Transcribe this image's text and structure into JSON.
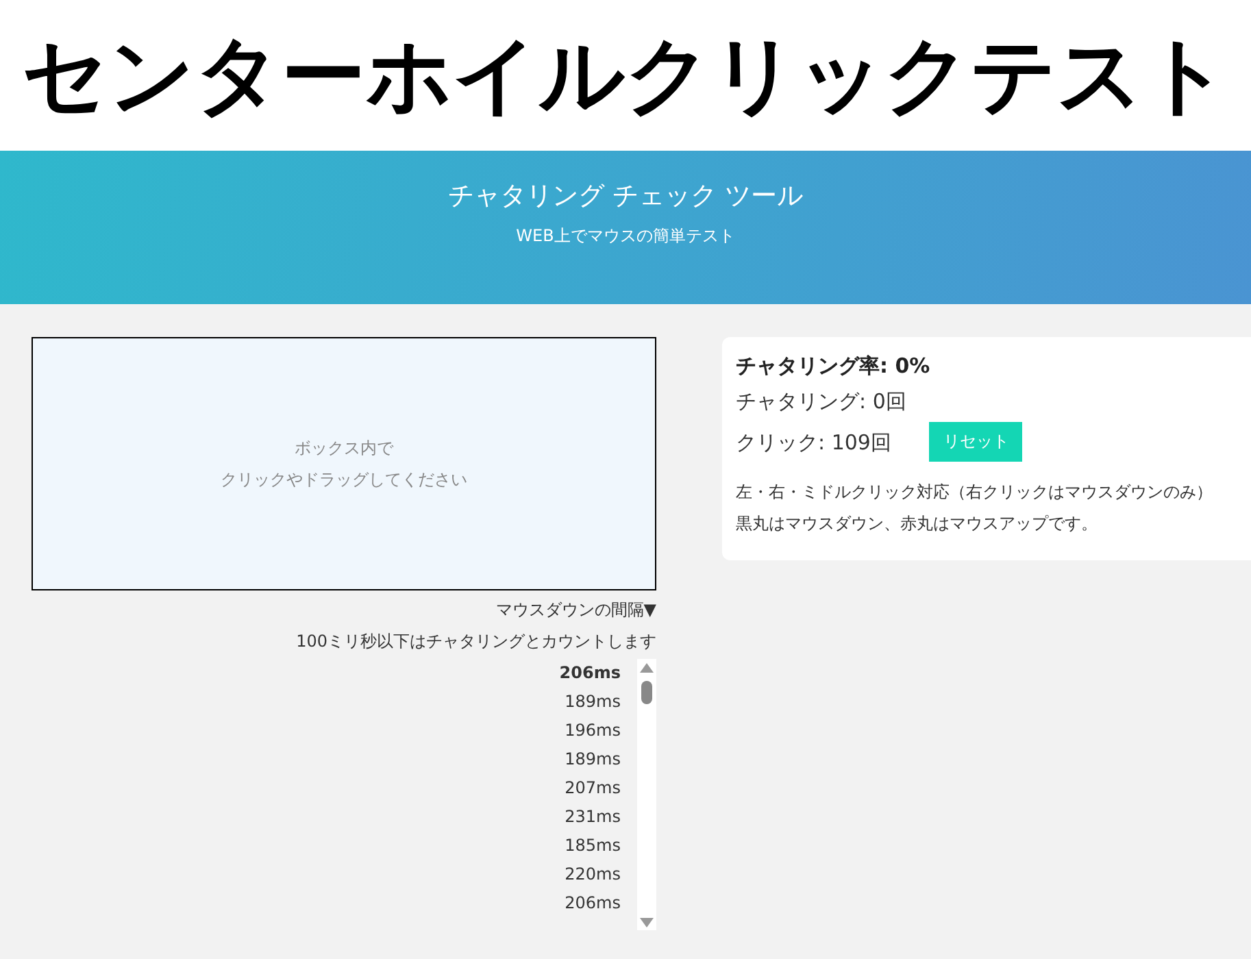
{
  "page_title": "センターホイルクリックテスト",
  "banner": {
    "title": "チャタリング チェック ツール",
    "subtitle": "WEB上でマウスの簡単テスト"
  },
  "test_area": {
    "line_1": "ボックス内で",
    "line_2": "クリックやドラッグしてください"
  },
  "interval_header": "マウスダウンの間隔▼",
  "interval_note": "100ミリ秒以下はチャタリングとカウントします",
  "intervals": [
    {
      "value": "206ms",
      "latest": true
    },
    {
      "value": "189ms",
      "latest": false
    },
    {
      "value": "196ms",
      "latest": false
    },
    {
      "value": "189ms",
      "latest": false
    },
    {
      "value": "207ms",
      "latest": false
    },
    {
      "value": "231ms",
      "latest": false
    },
    {
      "value": "185ms",
      "latest": false
    },
    {
      "value": "220ms",
      "latest": false
    },
    {
      "value": "206ms",
      "latest": false
    }
  ],
  "stats": {
    "rate": "チャタリング率: 0%",
    "chatter_count": "チャタリング: 0回",
    "click_count": "クリック: 109回",
    "reset_button": "リセット"
  },
  "notes": [
    "左・右・ミドルクリック対応（右クリックはマウスダウンのみ）",
    "黒丸はマウスダウン、赤丸はマウスアップです。"
  ]
}
